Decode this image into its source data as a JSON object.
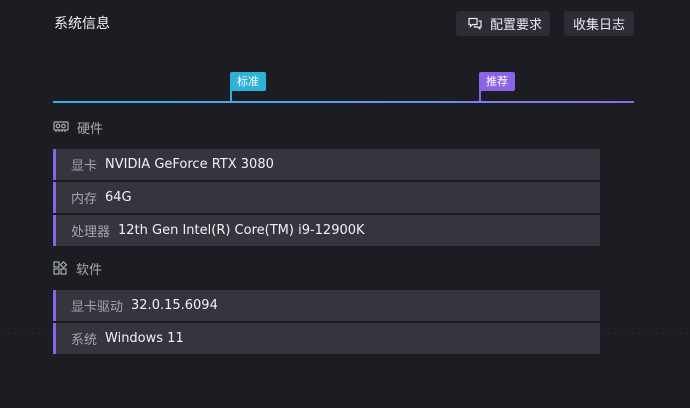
{
  "header": {
    "title": "系统信息",
    "requirements_label": "配置要求",
    "logs_label": "收集日志"
  },
  "tiers": {
    "standard_label": "标准",
    "recommended_label": "推荐"
  },
  "hardware": {
    "heading": "硬件",
    "icon": "gpu-card-icon",
    "rows": [
      {
        "label": "显卡",
        "value": "NVIDIA GeForce RTX 3080"
      },
      {
        "label": "内存",
        "value": "64G"
      },
      {
        "label": "处理器",
        "value": "12th Gen Intel(R) Core(TM) i9-12900K"
      }
    ]
  },
  "software": {
    "heading": "软件",
    "icon": "apps-grid-icon",
    "rows": [
      {
        "label": "显卡驱动",
        "value": "32.0.15.6094"
      },
      {
        "label": "系统",
        "value": "Windows 11"
      }
    ]
  },
  "colors": {
    "standard": "#2fb2d8",
    "recommended": "#8a63e6",
    "row_bg": "#34353d",
    "page_bg": "#1c1d23"
  }
}
